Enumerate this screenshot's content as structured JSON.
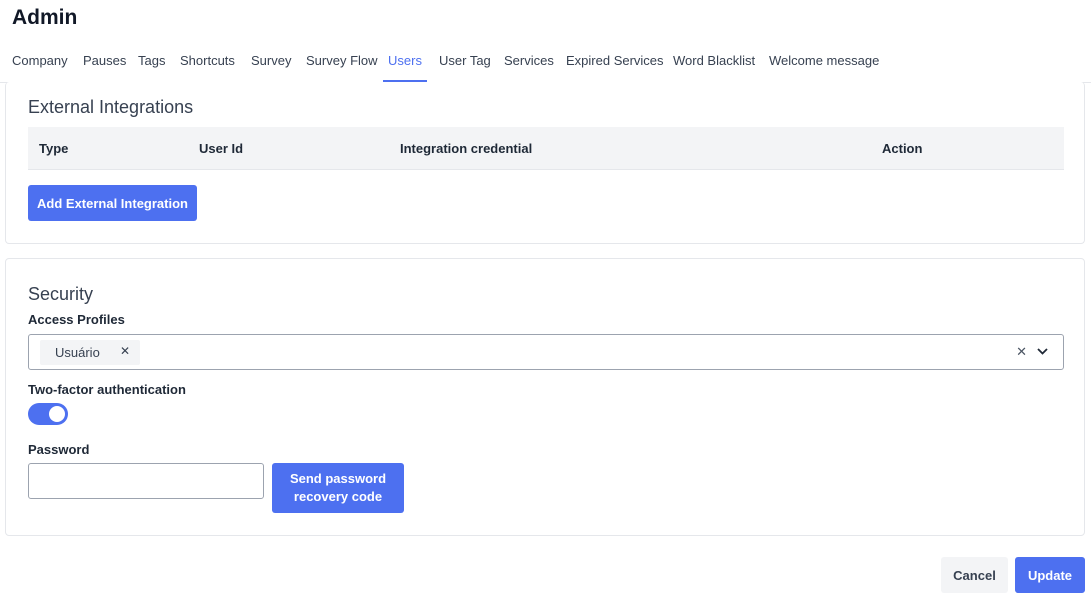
{
  "header": {
    "title": "Admin"
  },
  "tabs": [
    {
      "label": "Company"
    },
    {
      "label": "Pauses"
    },
    {
      "label": "Tags"
    },
    {
      "label": "Shortcuts"
    },
    {
      "label": "Survey"
    },
    {
      "label": "Survey Flow"
    },
    {
      "label": "Users",
      "active": true
    },
    {
      "label": "User Tag"
    },
    {
      "label": "Services"
    },
    {
      "label": "Expired Services"
    },
    {
      "label": "Word Blacklist"
    },
    {
      "label": "Welcome message"
    }
  ],
  "integrations": {
    "title": "External Integrations",
    "columns": [
      "Type",
      "User Id",
      "Integration credential",
      "Action"
    ],
    "rows": [],
    "add_button": "Add External Integration"
  },
  "security": {
    "title": "Security",
    "access_profiles": {
      "label": "Access Profiles",
      "selected": [
        "Usuário"
      ],
      "clear_icon": "clear-icon",
      "dropdown_icon": "chevron-down-icon"
    },
    "two_factor": {
      "label": "Two-factor authentication",
      "enabled": true
    },
    "password": {
      "label": "Password",
      "value": "",
      "placeholder": ""
    },
    "recovery_button": "Send password recovery code"
  },
  "footer": {
    "cancel_label": "Cancel",
    "update_label": "Update"
  },
  "colors": {
    "accent": "#4d70f0",
    "border": "#e5e7eb",
    "header_bg": "#f3f4f6"
  }
}
